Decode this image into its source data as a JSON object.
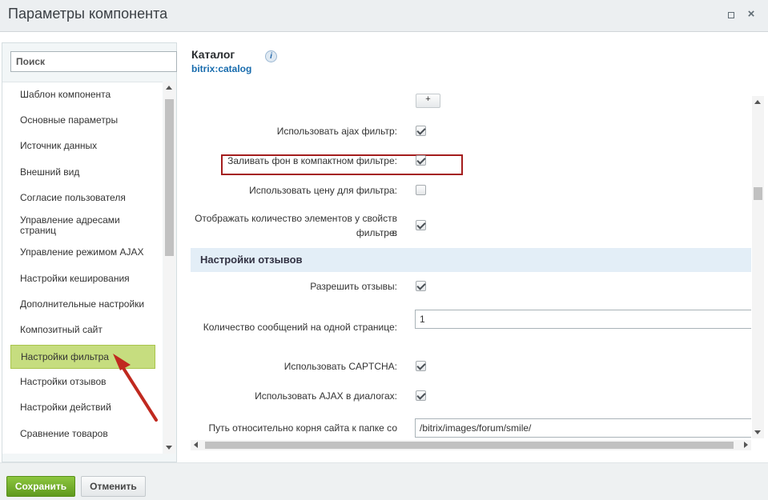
{
  "window": {
    "title": "Параметры компонента",
    "close_glyph": "×"
  },
  "sidebar": {
    "search_placeholder": "Поиск",
    "items": [
      {
        "label": "Шаблон компонента"
      },
      {
        "label": "Основные параметры"
      },
      {
        "label": "Источник данных"
      },
      {
        "label": "Внешний вид"
      },
      {
        "label": "Согласие пользователя"
      },
      {
        "label": "Управление адресами страниц"
      },
      {
        "label": "Управление режимом AJAX"
      },
      {
        "label": "Настройки кеширования"
      },
      {
        "label": "Дополнительные настройки"
      },
      {
        "label": "Композитный сайт"
      },
      {
        "label": "Настройки фильтра",
        "active": true
      },
      {
        "label": "Настройки отзывов"
      },
      {
        "label": "Настройки действий"
      },
      {
        "label": "Сравнение товаров"
      }
    ]
  },
  "component": {
    "title": "Каталог",
    "code": "bitrix:catalog",
    "info_icon": "i"
  },
  "params": {
    "plus_label": "+",
    "use_ajax_filter": {
      "label": "Использовать ajax фильтр:",
      "checked": true
    },
    "fill_compact_bg": {
      "label": "Заливать фон в компактном фильтре:",
      "checked": true
    },
    "use_price_filter": {
      "label": "Использовать цену для фильтра:",
      "checked": false
    },
    "show_count_line1": "Отображать количество элементов у свойств в",
    "show_count_line2": "фильтре:",
    "show_count_checked": true,
    "reviews_section": "Настройки отзывов",
    "allow_reviews": {
      "label": "Разрешить отзывы:",
      "checked": true
    },
    "messages_per_page": {
      "label": "Количество сообщений на одной странице:",
      "value": "1"
    },
    "use_captcha": {
      "label": "Использовать CAPTCHA:",
      "checked": true
    },
    "use_ajax_dialogs": {
      "label": "Использовать AJAX в диалогах:",
      "checked": true
    },
    "smiles_path": {
      "label": "Путь относительно корня сайта к папке со",
      "value": "/bitrix/images/forum/smile/"
    }
  },
  "footer": {
    "save_label": "Сохранить",
    "cancel_label": "Отменить"
  },
  "colors": {
    "active_item": "#c6dd7f",
    "highlight_box": "#a41d1d",
    "arrow": "#c0291f",
    "save_button": "#74ad2c",
    "link": "#176bad"
  }
}
